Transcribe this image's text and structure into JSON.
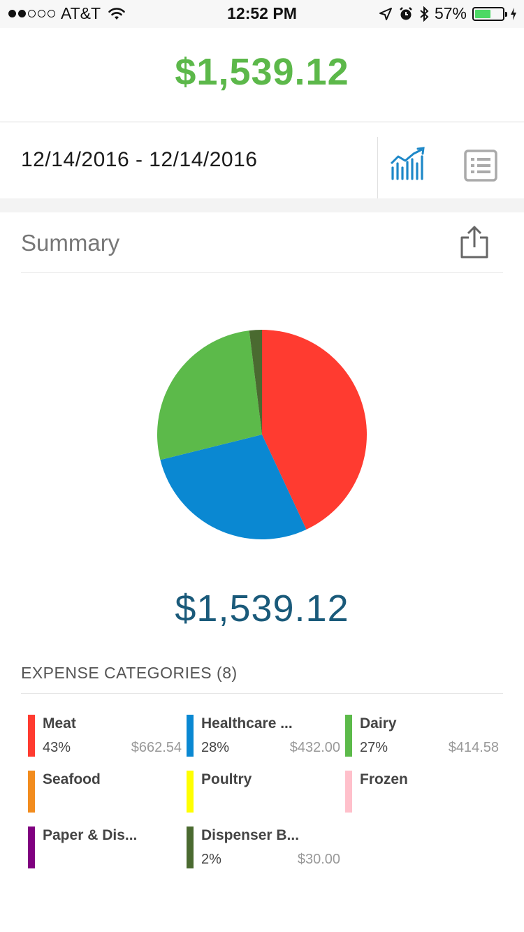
{
  "status_bar": {
    "carrier": "AT&T",
    "time": "12:52 PM",
    "battery_text": "57%",
    "battery_level": 0.57,
    "signal_filled": 2,
    "signal_total": 5
  },
  "header": {
    "total": "$1,539.12",
    "total_color": "#5cb84a"
  },
  "date_bar": {
    "range": "12/14/2016 - 12/14/2016",
    "chart_icon": "bar-chart-trend-icon",
    "list_icon": "list-view-icon",
    "accent": "#1e88c8"
  },
  "summary": {
    "title": "Summary",
    "share_icon": "share-icon",
    "total": "$1,539.12"
  },
  "chart_data": {
    "type": "pie",
    "slices": [
      {
        "label": "Meat",
        "value": 662.54,
        "color": "#ff3b30"
      },
      {
        "label": "Healthcare ...",
        "value": 432.0,
        "color": "#0a88d2"
      },
      {
        "label": "Dairy",
        "value": 414.58,
        "color": "#5cba4a"
      },
      {
        "label": "Dispenser B...",
        "value": 30.0,
        "color": "#4a6a30"
      }
    ]
  },
  "categories": {
    "header": "EXPENSE CATEGORIES (8)",
    "items": [
      {
        "name": "Meat",
        "percent": "43%",
        "amount": "$662.54",
        "color": "#ff3b30"
      },
      {
        "name": "Healthcare ...",
        "percent": "28%",
        "amount": "$432.00",
        "color": "#0a88d2"
      },
      {
        "name": "Dairy",
        "percent": "27%",
        "amount": "$414.58",
        "color": "#5cba4a"
      },
      {
        "name": "Seafood",
        "percent": "",
        "amount": "",
        "color": "#f28c1e"
      },
      {
        "name": "Poultry",
        "percent": "",
        "amount": "",
        "color": "#ffff00"
      },
      {
        "name": "Frozen",
        "percent": "",
        "amount": "",
        "color": "#ffc0cb"
      },
      {
        "name": "Paper & Dis...",
        "percent": "",
        "amount": "",
        "color": "#800080"
      },
      {
        "name": "Dispenser B...",
        "percent": "2%",
        "amount": "$30.00",
        "color": "#4a6a30"
      }
    ]
  }
}
